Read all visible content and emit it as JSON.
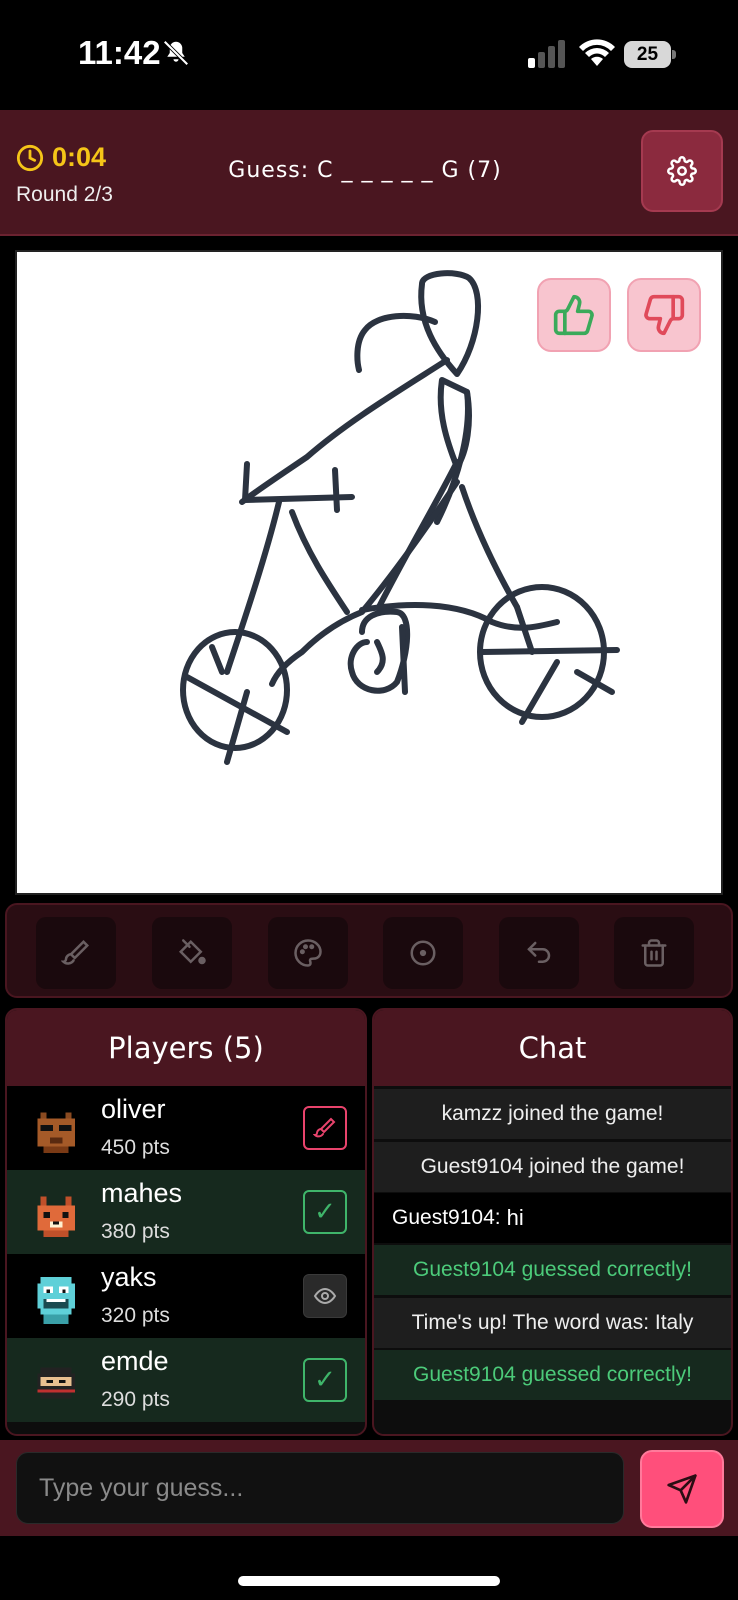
{
  "status_bar": {
    "time": "11:42",
    "battery": "25",
    "icons": [
      "bell-slash-icon",
      "signal-icon",
      "wifi-icon",
      "battery-icon"
    ]
  },
  "header": {
    "timer": "0:04",
    "round": "Round 2/3",
    "guess_word": "Guess: C _ _ _ _ _ G (7)",
    "timer_color": "#f5c518",
    "icons": [
      "clock-icon",
      "gear-icon"
    ]
  },
  "canvas": {
    "vote_icons": [
      "thumbs-up-icon",
      "thumbs-down-icon"
    ],
    "stroke_color": "#2b3340"
  },
  "toolbar": {
    "tools": [
      "brush-icon",
      "fill-bucket-icon",
      "palette-icon",
      "brush-size-icon",
      "undo-icon",
      "trash-icon"
    ]
  },
  "players": {
    "title": "Players (5)",
    "list": [
      {
        "name": "oliver",
        "points": "450 pts",
        "status": "drawing",
        "avatar": "cat-avatar"
      },
      {
        "name": "mahes",
        "points": "380 pts",
        "status": "guessed",
        "avatar": "fox-avatar"
      },
      {
        "name": "yaks",
        "points": "320 pts",
        "status": "spectating",
        "avatar": "smiley-avatar"
      },
      {
        "name": "emde",
        "points": "290 pts",
        "status": "guessed",
        "avatar": "ninja-avatar"
      }
    ],
    "check_symbol": "✓"
  },
  "chat": {
    "title": "Chat",
    "messages": [
      {
        "type": "system",
        "text": "kamzz joined the game!"
      },
      {
        "type": "system",
        "text": "Guest9104 joined the game!"
      },
      {
        "type": "user",
        "author": "Guest9104:",
        "text": "hi"
      },
      {
        "type": "correct",
        "text": "Guest9104 guessed correctly!"
      },
      {
        "type": "system",
        "text": "Time's up! The word was: Italy"
      },
      {
        "type": "correct",
        "text": "Guest9104 guessed correctly!"
      }
    ]
  },
  "input": {
    "placeholder": "Type your guess...",
    "value": "",
    "send_icon": "send-icon"
  },
  "colors": {
    "header_bg": "#4a1620",
    "accent_pink": "#ff4f7b",
    "correct_green": "#4ccb7a"
  }
}
